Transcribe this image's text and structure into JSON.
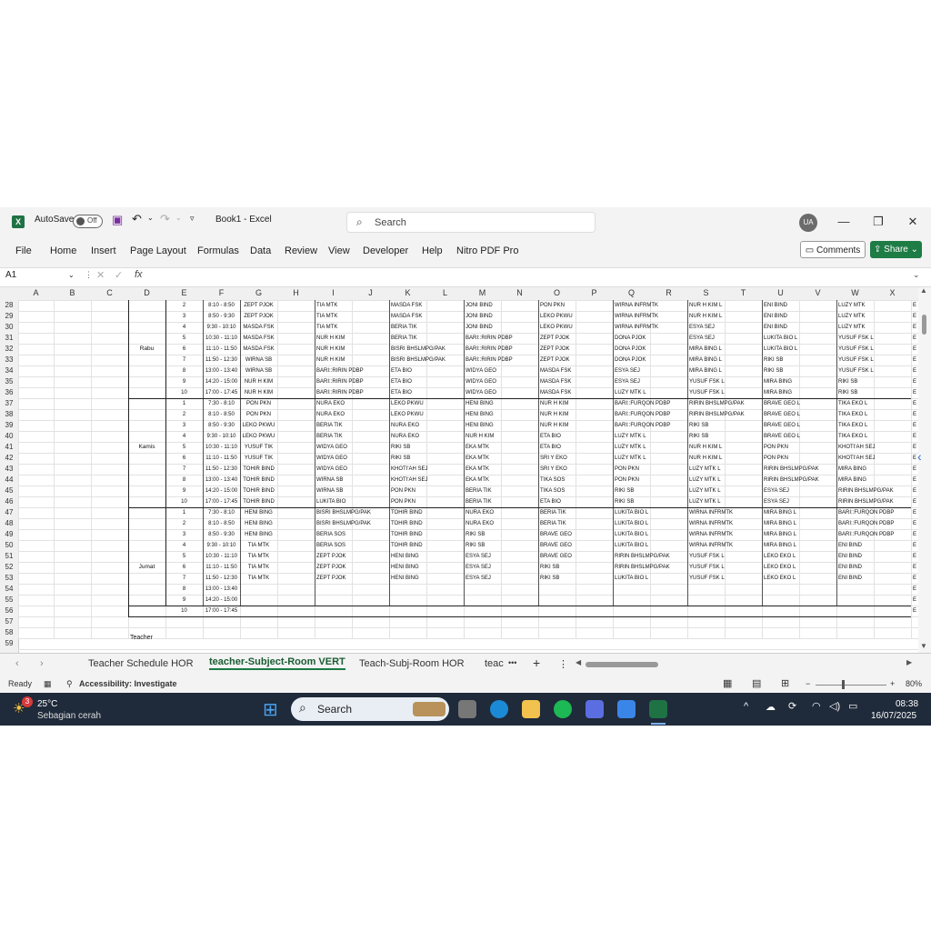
{
  "app": {
    "autosave_label": "AutoSave",
    "autosave_state": "Off",
    "doc_title": "Book1  -  Excel",
    "search_placeholder": "Search",
    "user_initials": "UA",
    "minimize": "—",
    "restore": "❐",
    "close": "✕"
  },
  "ribbon": {
    "tabs": [
      "File",
      "Home",
      "Insert",
      "Page Layout",
      "Formulas",
      "Data",
      "Review",
      "View",
      "Developer",
      "Help",
      "Nitro PDF Pro"
    ],
    "comments_label": "Comments",
    "share_label": "Share"
  },
  "formula_bar": {
    "cell_ref": "A1",
    "fx": "fx",
    "value": ""
  },
  "columns": [
    "A",
    "B",
    "C",
    "D",
    "E",
    "F",
    "G",
    "H",
    "I",
    "J",
    "K",
    "L",
    "M",
    "N",
    "O",
    "P",
    "Q",
    "R",
    "S",
    "T",
    "U",
    "V",
    "W",
    "X"
  ],
  "rows": [
    "28",
    "29",
    "30",
    "31",
    "32",
    "33",
    "34",
    "35",
    "36",
    "37",
    "38",
    "39",
    "40",
    "41",
    "42",
    "43",
    "44",
    "45",
    "46",
    "47",
    "48",
    "49",
    "50",
    "51",
    "52",
    "53",
    "54",
    "55",
    "56",
    "57",
    "58",
    "59"
  ],
  "days": [
    "Rabu",
    "Kamis",
    "Jumat"
  ],
  "schedule": [
    [
      "2",
      "8:10 - 8:50",
      "ZEPT PJOK",
      "TIA MTK",
      "MASDA FSK",
      "JONI BIND",
      "PON PKN",
      "WIRNA INFRMTK",
      "NUR H KIM L",
      "ENI BIND",
      "LUZY MTK"
    ],
    [
      "3",
      "8:50 - 9:30",
      "ZEPT PJOK",
      "TIA MTK",
      "MASDA FSK",
      "JONI BIND",
      "LEKO PKWU",
      "WIRNA INFRMTK",
      "NUR H KIM L",
      "ENI BIND",
      "LUZY MTK"
    ],
    [
      "4",
      "9:30 - 10:10",
      "MASDA FSK",
      "TIA MTK",
      "BERIA TIK",
      "JONI BIND",
      "LEKO PKWU",
      "WIRNA INFRMTK",
      "ESYA SEJ",
      "ENI BIND",
      "LUZY MTK"
    ],
    [
      "5",
      "10:30 - 11:10",
      "MASDA FSK",
      "NUR H KIM",
      "BERIA TIK",
      "BARI::RIRIN PDBP",
      "ZEPT PJOK",
      "DONA PJOK",
      "ESYA SEJ",
      "LUKITA BIO L",
      "YUSUF FSK L"
    ],
    [
      "6",
      "11:10 - 11:50",
      "MASDA FSK",
      "NUR H KIM",
      "BISRI BHSLMPG/PAK",
      "BARI::RIRIN PDBP",
      "ZEPT PJOK",
      "DONA PJOK",
      "MIRA BING L",
      "LUKITA BIO L",
      "YUSUF FSK L"
    ],
    [
      "7",
      "11:50 - 12:30",
      "WIRNA SB",
      "NUR H KIM",
      "BISRI BHSLMPG/PAK",
      "BARI::RIRIN PDBP",
      "ZEPT PJOK",
      "DONA PJOK",
      "MIRA BING L",
      "RIKI SB",
      "YUSUF FSK L"
    ],
    [
      "8",
      "13:00 - 13:40",
      "WIRNA SB",
      "BARI::RIRIN PDBP",
      "ETA BIO",
      "WIDYA GEO",
      "MASDA FSK",
      "ESYA SEJ",
      "MIRA BING L",
      "RIKI SB",
      "YUSUF FSK L"
    ],
    [
      "9",
      "14:20 - 15:00",
      "NUR H KIM",
      "BARI::RIRIN PDBP",
      "ETA BIO",
      "WIDYA GEO",
      "MASDA FSK",
      "ESYA SEJ",
      "YUSUF FSK L",
      "MIRA BING",
      "RIKI SB"
    ],
    [
      "10",
      "17:00 - 17:45",
      "NUR H KIM",
      "BARI::RIRIN PDBP",
      "ETA BIO",
      "WIDYA GEO",
      "MASDA FSK",
      "LUZY MTK L",
      "YUSUF FSK L",
      "MIRA BING",
      "RIKI SB"
    ],
    [
      "1",
      "7:30 - 8:10",
      "PON PKN",
      "NURA EKO",
      "LEKO PKWU",
      "HENI BING",
      "NUR H KIM",
      "BARI::FURQON PDBP",
      "RIRIN BHSLMPG/PAK",
      "BRAVE GEO L",
      "TIKA EKO L"
    ],
    [
      "2",
      "8:10 - 8:50",
      "PON PKN",
      "NURA EKO",
      "LEKO PKWU",
      "HENI BING",
      "NUR H KIM",
      "BARI::FURQON PDBP",
      "RIRIN BHSLMPG/PAK",
      "BRAVE GEO L",
      "TIKA EKO L"
    ],
    [
      "3",
      "8:50 - 9:30",
      "LEKO PKWU",
      "BERIA TIK",
      "NURA EKO",
      "HENI BING",
      "NUR H KIM",
      "BARI::FURQON PDBP",
      "RIKI SB",
      "BRAVE GEO L",
      "TIKA EKO L"
    ],
    [
      "4",
      "9:30 - 10:10",
      "LEKO PKWU",
      "BERIA TIK",
      "NURA EKO",
      "NUR H KIM",
      "ETA BIO",
      "LUZY MTK L",
      "RIKI SB",
      "BRAVE GEO L",
      "TIKA EKO L"
    ],
    [
      "5",
      "10:30 - 11:10",
      "YUSUF TIK",
      "WIDYA GEO",
      "RIKI SB",
      "EKA MTK",
      "ETA BIO",
      "LUZY MTK L",
      "NUR H KIM L",
      "PON PKN",
      "KHOTI'AH SEJ"
    ],
    [
      "6",
      "11:10 - 11:50",
      "YUSUF TIK",
      "WIDYA GEO",
      "RIKI SB",
      "EKA MTK",
      "SRI Y EKO",
      "LUZY MTK L",
      "NUR H KIM L",
      "PON PKN",
      "KHOTI'AH SEJ"
    ],
    [
      "7",
      "11:50 - 12:30",
      "TOHIR BIND",
      "WIDYA GEO",
      "KHOTI'AH SEJ",
      "EKA MTK",
      "SRI Y EKO",
      "PON PKN",
      "LUZY MTK L",
      "RIRIN BHSLMPG/PAK",
      "MIRA BING"
    ],
    [
      "8",
      "13:00 - 13:40",
      "TOHIR BIND",
      "WIRNA SB",
      "KHOTI'AH SEJ",
      "EKA MTK",
      "TIKA SOS",
      "PON PKN",
      "LUZY MTK L",
      "RIRIN BHSLMPG/PAK",
      "MIRA BING"
    ],
    [
      "9",
      "14:20 - 15:00",
      "TOHIR BIND",
      "WIRNA SB",
      "PON PKN",
      "BERIA TIK",
      "TIKA SOS",
      "RIKI SB",
      "LUZY MTK L",
      "ESYA SEJ",
      "RIRIN BHSLMPG/PAK"
    ],
    [
      "10",
      "17:00 - 17:45",
      "TOHIR BIND",
      "LUKITA BIO",
      "PON PKN",
      "BERIA TIK",
      "ETA BIO",
      "RIKI SB",
      "LUZY MTK L",
      "ESYA SEJ",
      "RIRIN BHSLMPG/PAK"
    ],
    [
      "1",
      "7:30 - 8:10",
      "HENI BING",
      "BISRI BHSLMPG/PAK",
      "TOHIR BIND",
      "NURA EKO",
      "BERIA TIK",
      "LUKITA BIO L",
      "WIRNA INFRMTK",
      "MIRA BING L",
      "BARI::FURQON PDBP"
    ],
    [
      "2",
      "8:10 - 8:50",
      "HENI BING",
      "BISRI BHSLMPG/PAK",
      "TOHIR BIND",
      "NURA EKO",
      "BERIA TIK",
      "LUKITA BIO L",
      "WIRNA INFRMTK",
      "MIRA BING L",
      "BARI::FURQON PDBP"
    ],
    [
      "3",
      "8:50 - 9:30",
      "HENI BING",
      "BERIA SOS",
      "TOHIR BIND",
      "RIKI SB",
      "BRAVE GEO",
      "LUKITA BIO L",
      "WIRNA INFRMTK",
      "MIRA BING L",
      "BARI::FURQON PDBP"
    ],
    [
      "4",
      "9:30 - 10:10",
      "TIA MTK",
      "BERIA SOS",
      "TOHIR BIND",
      "RIKI SB",
      "BRAVE GEO",
      "LUKITA BIO L",
      "WIRNA INFRMTK",
      "MIRA BING L",
      "ENI BIND"
    ],
    [
      "5",
      "10:30 - 11:10",
      "TIA MTK",
      "ZEPT PJOK",
      "HENI BING",
      "ESYA SEJ",
      "BRAVE GEO",
      "RIRIN BHSLMPG/PAK",
      "YUSUF FSK L",
      "LEKO EKO L",
      "ENI BIND"
    ],
    [
      "6",
      "11:10 - 11:50",
      "TIA MTK",
      "ZEPT PJOK",
      "HENI BING",
      "ESYA SEJ",
      "RIKI SB",
      "RIRIN BHSLMPG/PAK",
      "YUSUF FSK L",
      "LEKO EKO L",
      "ENI BIND"
    ],
    [
      "7",
      "11:50 - 12:30",
      "TIA MTK",
      "ZEPT PJOK",
      "HENI BING",
      "ESYA SEJ",
      "RIKI SB",
      "LUKITA BIO L",
      "YUSUF FSK L",
      "LEKO EKO L",
      "ENI BIND"
    ],
    [
      "8",
      "13:00 - 13:40",
      "",
      "",
      "",
      "",
      "",
      "",
      "",
      "",
      ""
    ],
    [
      "9",
      "14:20 - 15:00",
      "",
      "",
      "",
      "",
      "",
      "",
      "",
      "",
      ""
    ],
    [
      "10",
      "17:00 - 17:45",
      "",
      "",
      "",
      "",
      "",
      "",
      "",
      "",
      ""
    ]
  ],
  "footer_cell": "Teacher",
  "sheets": [
    "Teacher Schedule HOR",
    "teacher-Subject-Room VERT",
    "Teach-Subj-Room HOR",
    "teac"
  ],
  "status": {
    "ready": "Ready",
    "accessibility": "Accessibility: Investigate",
    "zoom": "80%"
  },
  "taskbar": {
    "weather_badge": "3",
    "temperature": "25°C",
    "weather_desc": "Sebagian cerah",
    "search_placeholder": "Search",
    "time": "08:38",
    "date": "16/07/2025"
  }
}
